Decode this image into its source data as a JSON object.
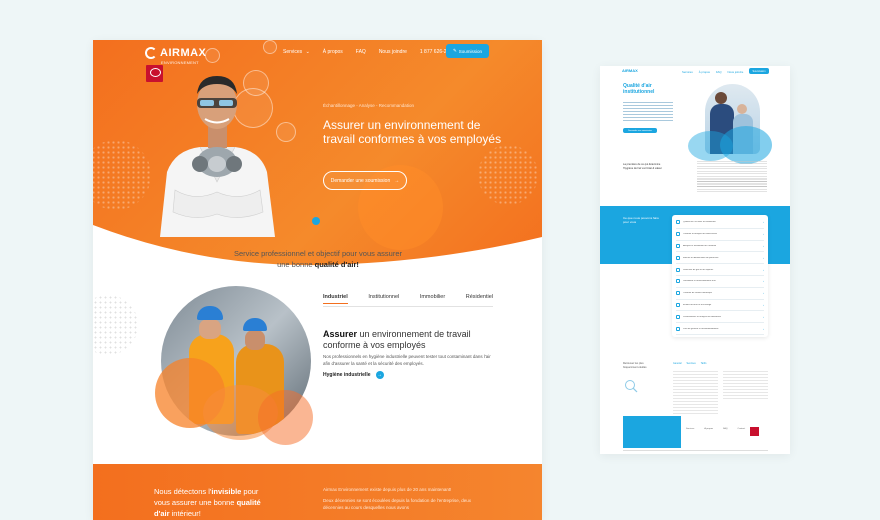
{
  "left": {
    "logo": {
      "name": "AIRMAX",
      "tagline": "ENVIRONNEMENT"
    },
    "nav": {
      "items": [
        "Services",
        "À propos",
        "FAQ",
        "Nous joindre",
        "1 877 626-2479"
      ],
      "cta": "Soumission"
    },
    "hero": {
      "breadcrumb": "Échantillonnage - Analyse - Recommandation",
      "title": "Assurer un environnement de travail conformes à vos employés",
      "button": "Demander une soumission"
    },
    "service": {
      "text_before": "Service professionnel et objectif pour vous assurer une bonne ",
      "text_bold": "qualité d'air!"
    },
    "tabs": [
      "Industriel",
      "Institutionnel",
      "Immobilier",
      "Résidentiel"
    ],
    "active_tab": "Industriel",
    "section": {
      "title_bold": "Assurer",
      "title_rest": " un environnement de travail conforme à vos employés",
      "description": "Nos professionnels en hygiène industrielle peuvent tester tout contaminant dans l'air afin d'assurer la santé et la sécurité des employés.",
      "link": "Hygiène industrielle"
    },
    "band": {
      "left_1": "Nous détectons l'",
      "left_bold": "invisible",
      "left_2": " pour vous assurer une bonne ",
      "left_bold2": "qualité d'air",
      "left_3": " intérieur!",
      "right_1": "Airmax Environnement existe depuis plus de 20 ans maintenant!",
      "right_2": "Deux décennies se sont écoulées depuis la fondation de l'entreprise, deux décennies au cours desquelles nous avons"
    }
  },
  "right": {
    "logo": "AIRMAX",
    "nav": [
      "Services",
      "À propos",
      "FAQ",
      "Nous joindre",
      "1 877 626-2479"
    ],
    "cta": "Soumission",
    "title": "Qualité d'air institutionnel",
    "button": "Demander une soumission",
    "mid_label": "La première de ce qui détermine l'hygiène de l'air est l'état & valeur",
    "blue_title": "Ce que nous pouvons faire pour vous",
    "list": [
      "Qualité de l'air dans les bâtiments",
      "Contrôle et analyse de moisissures",
      "Analyse et évaluation de l'amiante",
      "Mesure et identification de particules",
      "Détection de gaz et de vapeurs",
      "Ventilation et renouvellement d'air",
      "Contrôle de confort thermique",
      "Études de bruit et d'éclairage",
      "Prélèvements et analyse de laboratoire",
      "Plan de gestion et recommandations"
    ],
    "faq_label": "Retrouvez les plus fréquemment étudiés",
    "faq_tabs": [
      "Général",
      "Services",
      "Tarifs"
    ],
    "footer_cols": [
      "Services",
      "À propos",
      "FAQ",
      "Contact"
    ]
  },
  "colors": {
    "orange": "#f36f1e",
    "blue": "#1ba6e0"
  }
}
